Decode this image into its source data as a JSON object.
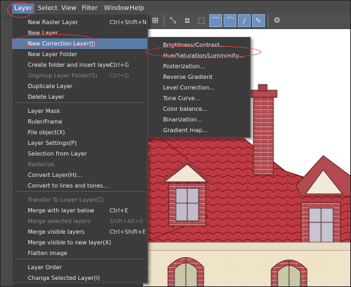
{
  "menubar": {
    "items": [
      "Layer",
      "Select",
      "View",
      "Filter",
      "Window",
      "Help"
    ]
  },
  "layer_menu": {
    "items": [
      {
        "label": "New Raster Layer",
        "shortcut": "Ctrl+Shift+N"
      },
      {
        "label": "New Layer",
        "submenu": true
      },
      {
        "label": "New Correction Layer(J)",
        "submenu": true
      },
      {
        "label": "New Layer Folder"
      },
      {
        "label": "Create folder and insert layer",
        "shortcut": "Ctrl+G"
      },
      {
        "label": "Ungroup Layer Folder(S)",
        "shortcut": "Ctrl+G"
      },
      {
        "label": "Duplicate Layer"
      },
      {
        "label": "Delete Layer"
      },
      {
        "label": "Layer Mask",
        "submenu": true
      },
      {
        "label": "Ruler/Frame",
        "submenu": true
      },
      {
        "label": "File object(X)",
        "submenu": true
      },
      {
        "label": "Layer Settings(P)",
        "submenu": true
      },
      {
        "label": "Selection from Layer",
        "submenu": true
      },
      {
        "label": "Rasterize"
      },
      {
        "label": "Convert Layer(H)..."
      },
      {
        "label": "Convert to lines and tones..."
      },
      {
        "label": "Transfer To Lower Layer(C)"
      },
      {
        "label": "Merge with layer below",
        "shortcut": "Ctrl+E"
      },
      {
        "label": "Merge selected layers",
        "shortcut": "Shift+Alt+E"
      },
      {
        "label": "Merge visible layers",
        "shortcut": "Ctrl+Shift+E"
      },
      {
        "label": "Merge visible to new layer(X)"
      },
      {
        "label": "Flatten image"
      },
      {
        "label": "Layer Order",
        "submenu": true
      },
      {
        "label": "Change Selected Layer(I)",
        "submenu": true
      }
    ]
  },
  "correction_submenu": {
    "items": [
      "Brightness/Contrast...",
      "Hue/Saturation/Luminosity...",
      "Posterization...",
      "Reverse Gradient",
      "Level Correction...",
      "Tone Curve...",
      "Color balance...",
      "Binarization...",
      "Gradient map..."
    ]
  },
  "colors": {
    "menu_bg": "#3b3b3b",
    "highlight": "#5c7da8",
    "roof": "#b8323c",
    "brick": "#b54a4f",
    "annotation": "#e03b3b"
  }
}
